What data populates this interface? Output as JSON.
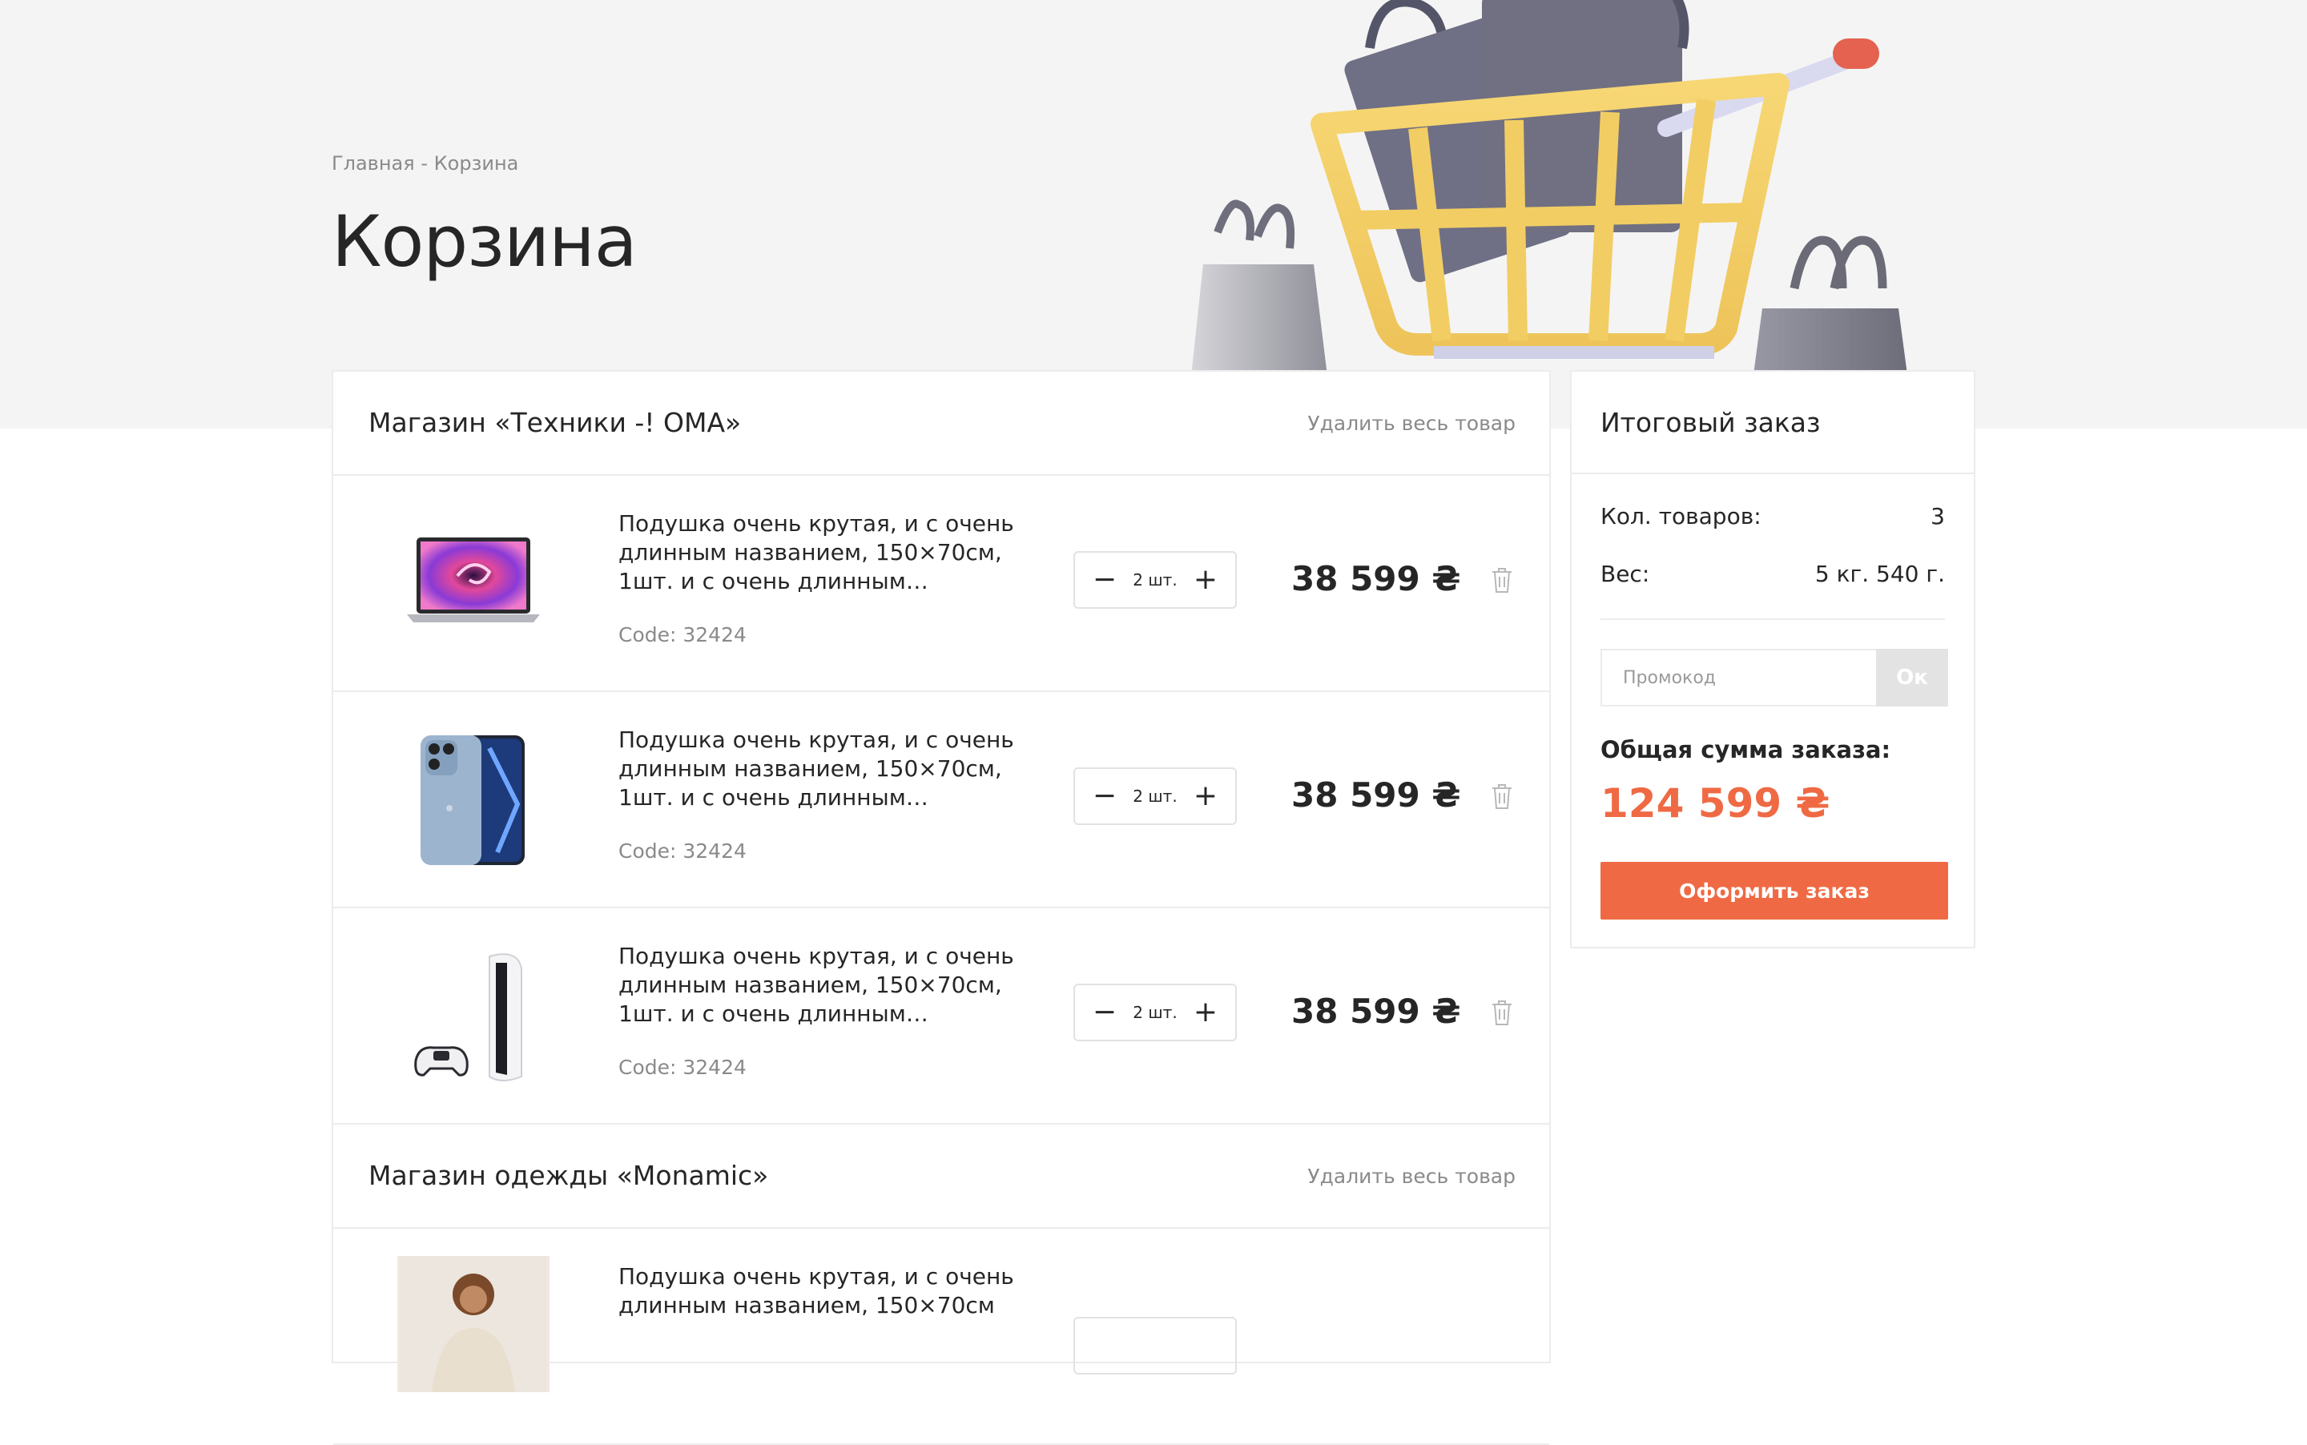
{
  "breadcrumb": {
    "home": "Главная",
    "separator": "-",
    "current": "Корзина"
  },
  "page_title": "Корзина",
  "stores": [
    {
      "title": "Магазин «Техники -! ОМА»",
      "remove_all": "Удалить весь товар",
      "items": [
        {
          "name": "Подушка очень крутая, и с очень длинным названием, 150×70см, 1шт. и с очень длинным…",
          "code": "Code: 32424",
          "qty": "2 шт.",
          "price": "38 599 ₴",
          "image": "laptop-image"
        },
        {
          "name": "Подушка очень крутая, и с очень длинным названием, 150×70см, 1шт. и с очень длинным…",
          "code": "Code: 32424",
          "qty": "2 шт.",
          "price": "38 599 ₴",
          "image": "phone-image"
        },
        {
          "name": "Подушка очень крутая, и с очень длинным названием, 150×70см, 1шт. и с очень длинным…",
          "code": "Code: 32424",
          "qty": "2 шт.",
          "price": "38 599 ₴",
          "image": "console-image"
        }
      ]
    },
    {
      "title": "Магазин одежды «Monamic»",
      "remove_all": "Удалить весь товар",
      "items": [
        {
          "name": "Подушка очень крутая, и с очень длинным названием, 150×70см",
          "image": "clothing-image"
        }
      ]
    }
  ],
  "summary": {
    "title": "Итоговый заказ",
    "count_label": "Кол. товаров:",
    "count_value": "3",
    "weight_label": "Вес:",
    "weight_value": "5 кг. 540 г.",
    "promo_placeholder": "Промокод",
    "promo_button": "Ок",
    "total_label": "Общая сумма заказа:",
    "total_value": "124 599 ₴",
    "checkout_button": "Оформить заказ"
  },
  "qty_controls": {
    "minus": "−",
    "plus": "+"
  },
  "colors": {
    "accent": "#ef6a44",
    "hero_bg": "#f4f4f4",
    "muted": "#8a8a8a"
  }
}
